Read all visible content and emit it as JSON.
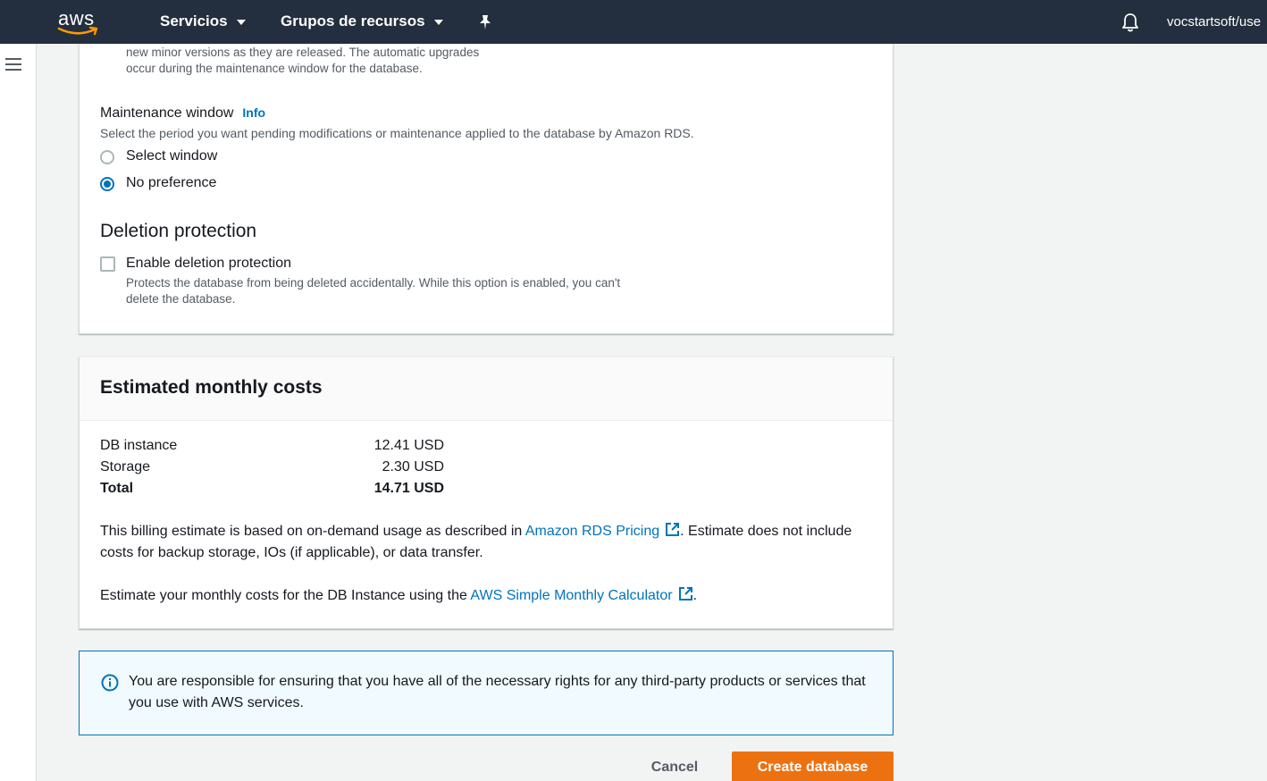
{
  "topnav": {
    "logo_text": "aws",
    "services_label": "Servicios",
    "resource_groups_label": "Grupos de recursos",
    "user_label": "vocstartsoft/use",
    "icons": [
      "pin-icon",
      "bell-icon",
      "caret-down-icon"
    ]
  },
  "sidebar": {
    "icon": "menu-icon"
  },
  "panel1": {
    "minor_version_desc_line1": "new minor versions as they are released. The automatic upgrades",
    "minor_version_desc_line2": "occur during the maintenance window for the database.",
    "maintenance": {
      "label": "Maintenance window",
      "info": "Info",
      "description": "Select the period you want pending modifications or maintenance applied to the database by Amazon RDS.",
      "options": [
        {
          "label": "Select window",
          "checked": false
        },
        {
          "label": "No preference",
          "checked": true
        }
      ]
    },
    "deletion": {
      "title": "Deletion protection",
      "checkbox_label": "Enable deletion protection",
      "checked": false,
      "desc_line1": "Protects the database from being deleted accidentally. While this option is enabled, you can't",
      "desc_line2": "delete the database."
    }
  },
  "costs": {
    "title": "Estimated monthly costs",
    "rows": [
      {
        "label": "DB instance",
        "value": "12.41 USD"
      },
      {
        "label": "Storage",
        "value": "2.30 USD"
      },
      {
        "label": "Total",
        "value": "14.71 USD"
      }
    ],
    "billing_prefix": "This billing estimate is based on on-demand usage as described in ",
    "billing_link": "Amazon RDS Pricing",
    "billing_suffix": ". Estimate does not include costs for backup storage, IOs (if applicable), or data transfer.",
    "calc_prefix": "Estimate your monthly costs for the DB Instance using the ",
    "calc_link": "AWS Simple Monthly Calculator",
    "calc_suffix": "."
  },
  "alert": {
    "text": "You are responsible for ensuring that you have all of the necessary rights for any third-party products or services that you use with AWS services."
  },
  "footer": {
    "cancel_label": "Cancel",
    "create_label": "Create database"
  },
  "colors": {
    "nav_bg": "#232f3e",
    "link": "#0073bb",
    "primary_button": "#ec7211",
    "alert_bg": "#f1faff"
  }
}
